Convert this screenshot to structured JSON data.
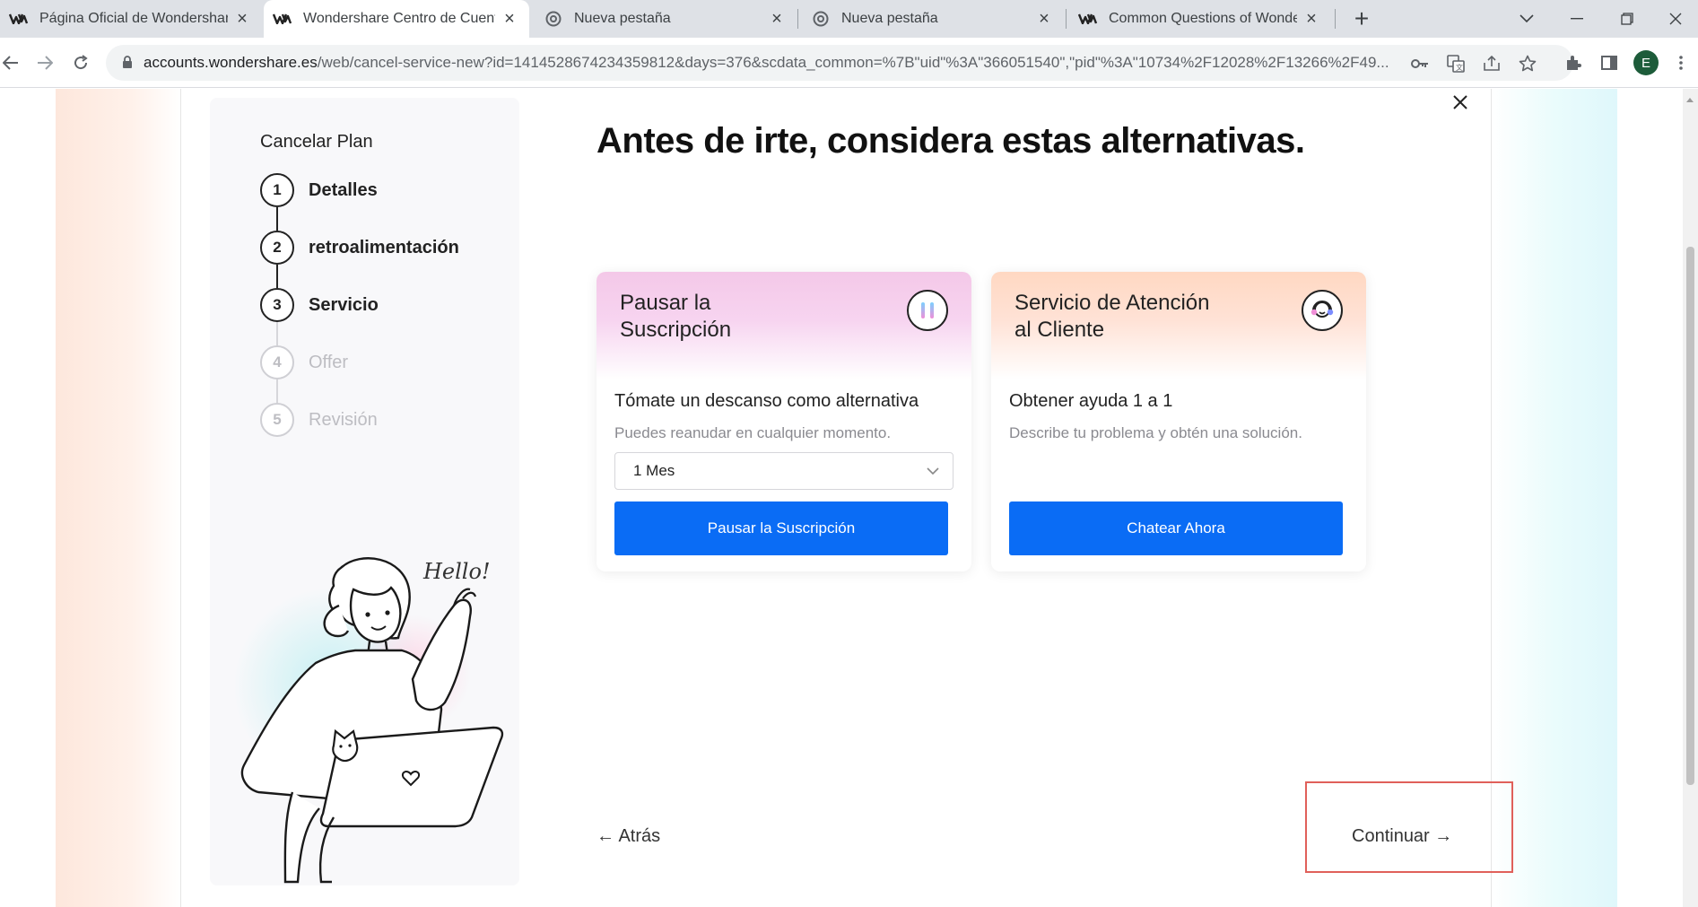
{
  "browser": {
    "tabs": [
      {
        "title": "Página Oficial de Wondershare: C",
        "favicon": "wondershare-logo",
        "active": false
      },
      {
        "title": "Wondershare Centro de Cuenta",
        "favicon": "wondershare-logo",
        "active": true
      },
      {
        "title": "Nueva pestaña",
        "favicon": "chrome-logo",
        "active": false
      },
      {
        "title": "Nueva pestaña",
        "favicon": "chrome-logo",
        "active": false
      },
      {
        "title": "Common Questions of Wondersh",
        "favicon": "wondershare-logo",
        "active": false
      }
    ],
    "url_host": "accounts.wondershare.es",
    "url_path": "/web/cancel-service-new?id=1414528674234359812&days=376&scdata_common=%7B\"uid\"%3A\"366051540\",\"pid\"%3A\"10734%2F12028%2F13266%2F49...",
    "profile_initial": "E"
  },
  "sidebar": {
    "title": "Cancelar Plan",
    "steps": [
      {
        "number": "1",
        "label": "Detalles",
        "state": "done"
      },
      {
        "number": "2",
        "label": "retroalimentación",
        "state": "done"
      },
      {
        "number": "3",
        "label": "Servicio",
        "state": "current"
      },
      {
        "number": "4",
        "label": "Offer",
        "state": "pending"
      },
      {
        "number": "5",
        "label": "Revisión",
        "state": "pending"
      }
    ],
    "illustration_text": "Hello!"
  },
  "main": {
    "headline": "Antes de irte, considera estas alternativas.",
    "cards": [
      {
        "title": "Pausar la Suscripción",
        "icon": "pause-icon",
        "subtitle": "Tómate un descanso como alternativa",
        "description": "Puedes reanudar en cualquier momento.",
        "select_value": "1 Mes",
        "button_label": "Pausar la Suscripción"
      },
      {
        "title": "Servicio de Atención al Cliente",
        "icon": "support-agent-icon",
        "subtitle": "Obtener ayuda 1 a 1",
        "description": "Describe tu problema y obtén una solución.",
        "button_label": "Chatear Ahora"
      }
    ],
    "back_label": "← Atrás",
    "continue_label": "Continuar →"
  },
  "colors": {
    "primary_button": "#0a6cf5",
    "highlight_box": "#e0605a"
  }
}
